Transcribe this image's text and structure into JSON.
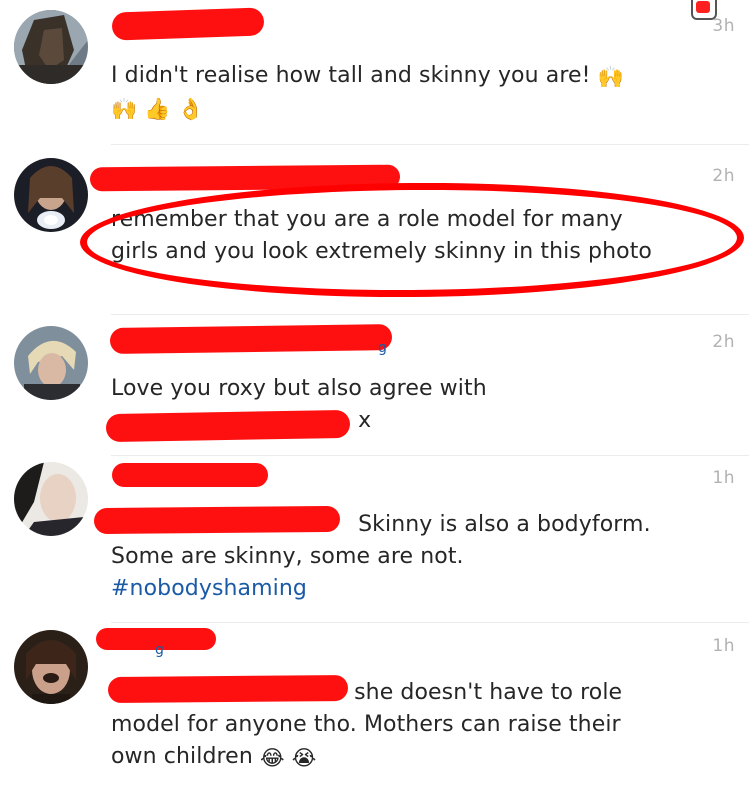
{
  "badge": {
    "color": "#ff2020"
  },
  "comments": [
    {
      "timestamp": "3h",
      "text_line1": "I didn't realise how tall and skinny you are!",
      "emoji_inline": "🙌",
      "emoji_line2": [
        "🙌",
        "👍",
        "👌"
      ]
    },
    {
      "timestamp": "2h",
      "text_line1": "remember that you are a role model for many",
      "text_line2": "girls and you look extremely skinny in this photo",
      "highlighted": true
    },
    {
      "timestamp": "2h",
      "text_line1": "Love you roxy but also agree with",
      "text_line2_tail": "x"
    },
    {
      "timestamp": "1h",
      "text_line1_tail": "Skinny is also a bodyform.",
      "text_line2": "Some are skinny, some are not.",
      "hashtag": "#nobodyshaming"
    },
    {
      "timestamp": "1h",
      "text_line1_tail": "she doesn't have to role",
      "text_line2": "model for anyone tho. Mothers can raise their",
      "text_line3": "own children",
      "emoji_end": [
        "😂",
        "😭"
      ]
    }
  ],
  "colors": {
    "redaction": "#ff1010",
    "hashtag": "#1a5aa6",
    "timestamp": "#b2b2b2",
    "text": "#262626"
  }
}
